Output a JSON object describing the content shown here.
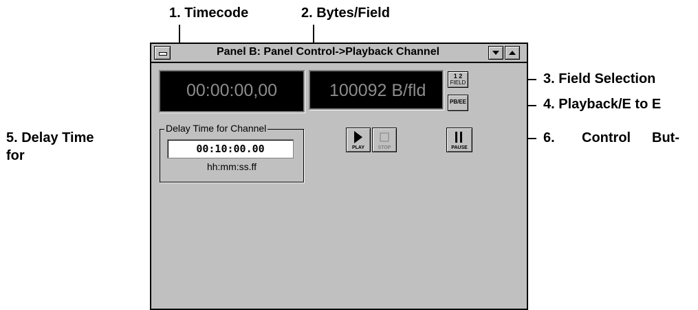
{
  "callouts": {
    "timecode": "1. Timecode",
    "bytes_field": "2. Bytes/Field",
    "field_selection": "3. Field Selection",
    "playback_ee": "4. Playback/E to E",
    "delay_time_line1": "5. Delay Time",
    "delay_time_line2": "for",
    "control_buttons_1": "6.",
    "control_buttons_2": "Control",
    "control_buttons_3": "But-"
  },
  "window": {
    "title": "Panel B: Panel Control->Playback Channel"
  },
  "displays": {
    "timecode": "00:00:00,00",
    "bytes_per_field": "100092 B/fld"
  },
  "field_button": {
    "line1": "1 2",
    "line2": "FIELD"
  },
  "pbee_button": {
    "label": "PB/EE"
  },
  "delay_group": {
    "legend": "Delay Time for Channel",
    "value": "00:10:00.00",
    "format_hint": "hh:mm:ss.ff"
  },
  "controls": {
    "play_label": "PLAY",
    "stop_label": "STOP",
    "pause_label": "PAUSE"
  },
  "icons": {
    "system_menu": "system-menu-icon",
    "minimize": "minimize-arrow-icon",
    "maximize": "maximize-arrow-icon",
    "play": "play-icon",
    "stop": "stop-icon",
    "pause": "pause-icon"
  }
}
